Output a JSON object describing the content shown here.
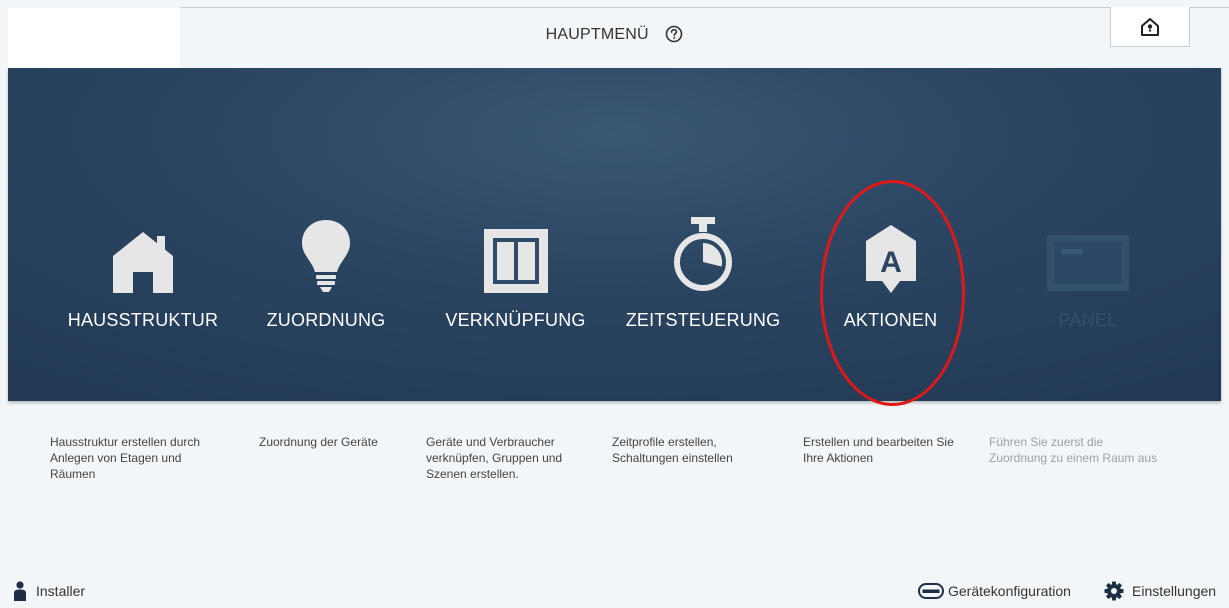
{
  "header": {
    "title": "HAUPTMENÜ",
    "help_icon": "help-circle-icon",
    "home_icon": "house-info-icon"
  },
  "tiles": [
    {
      "label": "HAUSSTRUKTUR",
      "icon": "house-icon",
      "description": "Hausstruktur erstellen durch Anlegen von Etagen und Räumen",
      "enabled": true
    },
    {
      "label": "ZUORDNUNG",
      "icon": "lightbulb-icon",
      "description": "Zuordnung der Geräte",
      "enabled": true
    },
    {
      "label": "VERKNÜPFUNG",
      "icon": "window-panel-icon",
      "description": "Geräte und Verbraucher verknüpfen, Gruppen und Szenen erstellen.",
      "enabled": true
    },
    {
      "label": "ZEITSTEUERUNG",
      "icon": "stopwatch-icon",
      "description": "Zeitprofile erstellen, Schaltungen einstellen",
      "enabled": true
    },
    {
      "label": "AKTIONEN",
      "icon": "action-a-icon",
      "description": "Erstellen und bearbeiten Sie Ihre Aktionen",
      "enabled": true,
      "highlighted": true
    },
    {
      "label": "PANEL",
      "icon": "panel-display-icon",
      "description": "Führen Sie zuerst die Zuordnung zu einem Raum aus",
      "enabled": false
    }
  ],
  "footer": {
    "installer": "Installer",
    "device_config": "Gerätekonfiguration",
    "settings": "Einstellungen"
  },
  "colors": {
    "panel_bg": "#2b4562",
    "tile_icon": "#e8e8e8",
    "highlight": "#e01818",
    "page_bg": "#f3f6f8"
  }
}
